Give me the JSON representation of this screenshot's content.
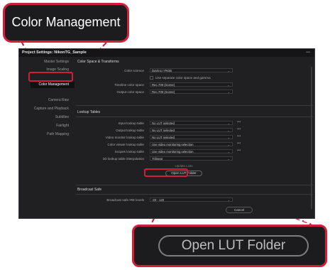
{
  "dialog": {
    "title": "Project Settings:  NikonTG_Sample",
    "menu_dots": "•••"
  },
  "sidebar": {
    "items": [
      {
        "label": "Master Settings"
      },
      {
        "label": "Image Scaling"
      },
      {
        "label": "Color Management"
      },
      {
        "label": "Camera Raw"
      },
      {
        "label": "Capture and Playback"
      },
      {
        "label": "Subtitles"
      },
      {
        "label": "Fairlight"
      },
      {
        "label": "Path Mapping"
      }
    ]
  },
  "color_space": {
    "section_title": "Color Space & Transforms",
    "color_science_label": "Color science",
    "color_science_value": "DaVinci YRGB",
    "separate_gamma_label": "Use separate color space and gamma",
    "timeline_label": "Timeline color space",
    "timeline_value": "Rec.709 (Scene)",
    "output_label": "Output color space",
    "output_value": "Rec.709 (Scene)"
  },
  "lookup_tables": {
    "section_title": "Lookup Tables",
    "rows": [
      {
        "label": "Input lookup table",
        "value": "No LUT selected"
      },
      {
        "label": "Output lookup table",
        "value": "No LUT selected"
      },
      {
        "label": "Video monitor lookup table",
        "value": "No LUT selected"
      },
      {
        "label": "Color viewer lookup table",
        "value": "Use video monitoring selection"
      },
      {
        "label": "Scopes lookup table",
        "value": "Use video monitoring selection"
      },
      {
        "label": "3D lookup table interpolation",
        "value": "Trilinear"
      }
    ],
    "update_lists": "Update Lists",
    "open_lut_folder": "Open LUT Folder"
  },
  "broadcast_safe": {
    "section_title": "Broadcast Safe",
    "ire_label": "Broadcast safe IRE levels",
    "ire_value": "-20 - 120"
  },
  "footer": {
    "cancel_label": "Cancel"
  },
  "callouts": {
    "top_label": "Color Management",
    "bottom_label": "Open LUT Folder"
  },
  "colors": {
    "highlight": "#d11f3a",
    "panel": "#202022"
  }
}
